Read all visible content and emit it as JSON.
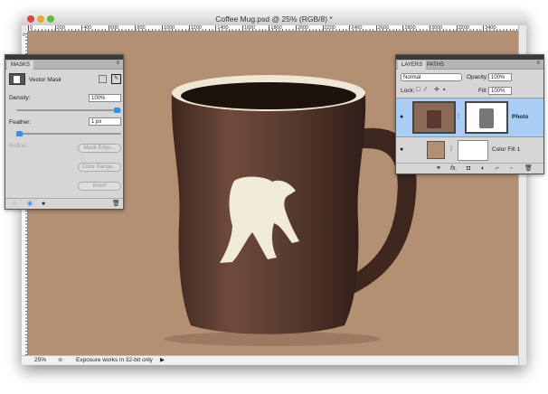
{
  "window": {
    "title": "Coffee Mug.psd @ 25% (RGB/8) *"
  },
  "ruler": {
    "top_ticks": [
      "0",
      "200",
      "400",
      "600",
      "800",
      "1000",
      "1200",
      "1400",
      "1600",
      "1800",
      "2000",
      "2200",
      "2400",
      "2600",
      "2800",
      "3000",
      "3200",
      "3400"
    ],
    "left_first": "0"
  },
  "status": {
    "zoom": "25%",
    "info": "Exposure works in 32-bit only"
  },
  "masks": {
    "tab": "MASKS",
    "mask_type": "Vector Mask",
    "density_label": "Density:",
    "density_value": "100%",
    "density_level": 1.0,
    "feather_label": "Feather:",
    "feather_value": "1 px",
    "feather_level": 0.0,
    "refine_label": "Refine:",
    "mask_edge": "Mask Edge...",
    "color_range": "Color Range...",
    "invert": "Invert"
  },
  "layers": {
    "tabs": [
      "LAYERS",
      "PATHS"
    ],
    "blend_mode": "Normal",
    "opacity_label": "Opacity:",
    "opacity_value": "100%",
    "lock_label": "Lock:",
    "fill_label": "Fill:",
    "fill_value": "100%",
    "items": [
      {
        "name": "Photo",
        "selected": true
      },
      {
        "name": "Color Fill 1",
        "selected": false
      }
    ],
    "fx_label": "fx."
  },
  "colors": {
    "canvas": "#b38f74",
    "mug": "#5a3a2e",
    "selection": "#a9cdf5",
    "accent": "#3b8fe0"
  }
}
